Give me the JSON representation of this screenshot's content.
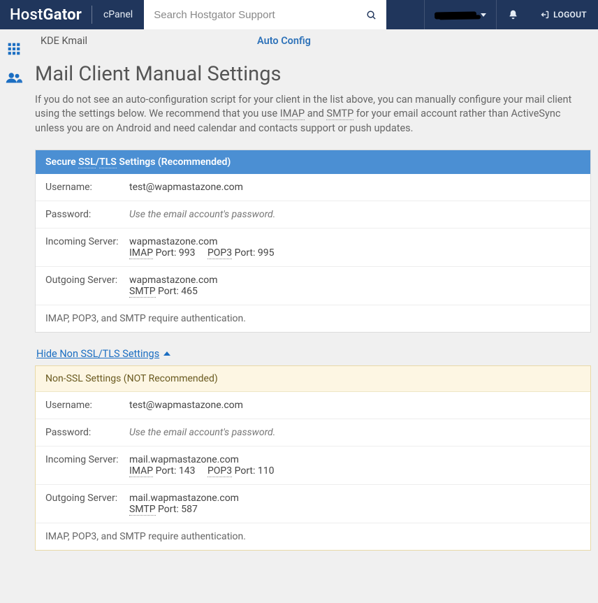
{
  "header": {
    "brand_prefix": "Host",
    "brand_suffix": "Gator",
    "cpanel": "cPanel",
    "search_placeholder": "Search Hostgator Support",
    "logout": "LOGOUT"
  },
  "breadcrumb": {
    "app": "KDE Kmail",
    "action": "Auto Config"
  },
  "page": {
    "title": "Mail Client Manual Settings",
    "intro_a": "If you do not see an auto-configuration script for your client in the list above, you can manually configure your mail client using the settings below. We recommend that you use ",
    "intro_imap": "IMAP",
    "intro_and": " and ",
    "intro_smtp": "SMTP",
    "intro_b": " for your email account rather than ActiveSync unless you are on Android and need calendar and contacts support or push updates."
  },
  "ssl_panel": {
    "header_a": "Secure ",
    "header_ssl": "SSL",
    "header_slash": "/",
    "header_tls": "TLS",
    "header_b": " Settings (Recommended)",
    "rows": {
      "username_label": "Username:",
      "username_value": "test@wapmastazone.com",
      "password_label": "Password:",
      "password_value": "Use the email account's password.",
      "incoming_label": "Incoming Server:",
      "incoming_server": "wapmastazone.com",
      "imap_abbr": "IMAP",
      "imap_port": " Port: 993",
      "pop3_abbr": "POP3",
      "pop3_port": " Port: 995",
      "outgoing_label": "Outgoing Server:",
      "outgoing_server": "wapmastazone.com",
      "smtp_abbr": "SMTP",
      "smtp_port": " Port: 465"
    },
    "note": "IMAP, POP3, and SMTP require authentication."
  },
  "toggle": {
    "label": "Hide Non SSL/TLS Settings"
  },
  "nonssl_panel": {
    "header": "Non-SSL Settings (NOT Recommended)",
    "rows": {
      "username_label": "Username:",
      "username_value": "test@wapmastazone.com",
      "password_label": "Password:",
      "password_value": "Use the email account's password.",
      "incoming_label": "Incoming Server:",
      "incoming_server": "mail.wapmastazone.com",
      "imap_abbr": "IMAP",
      "imap_port": " Port: 143",
      "pop3_abbr": "POP3",
      "pop3_port": " Port: 110",
      "outgoing_label": "Outgoing Server:",
      "outgoing_server": "mail.wapmastazone.com",
      "smtp_abbr": "SMTP",
      "smtp_port": " Port: 587"
    },
    "note": "IMAP, POP3, and SMTP require authentication."
  }
}
